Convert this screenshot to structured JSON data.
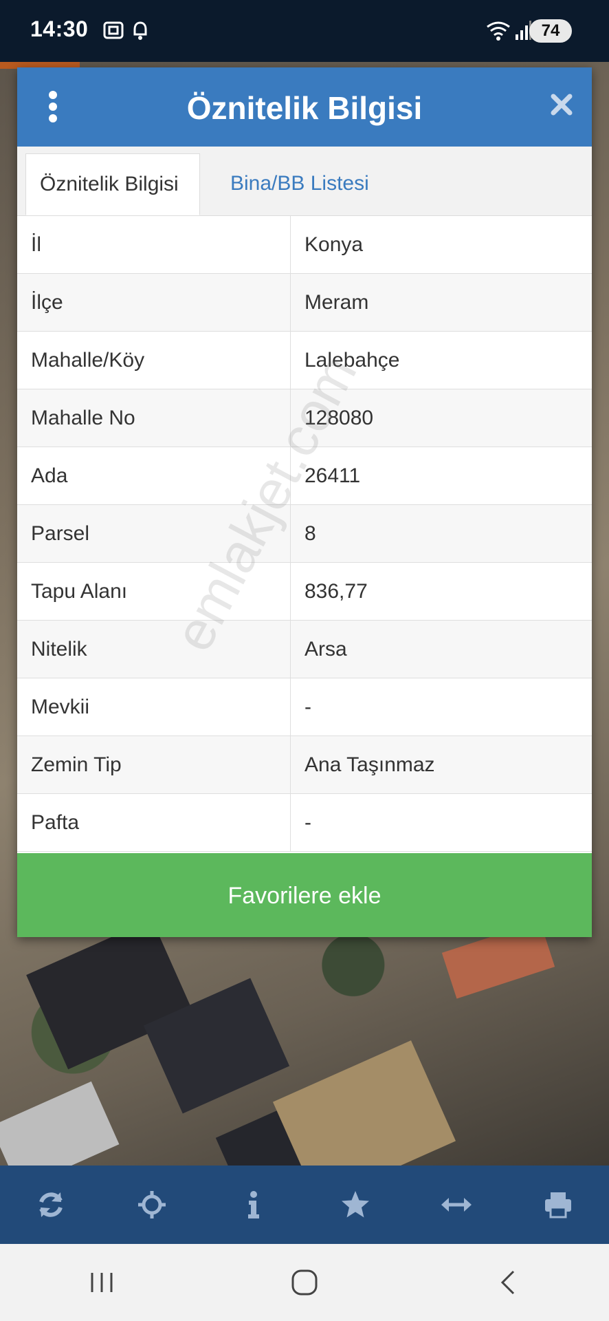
{
  "status_bar": {
    "time": "14:30",
    "battery": "74"
  },
  "dialog": {
    "title": "Öznitelik Bilgisi",
    "tabs": [
      {
        "label": "Öznitelik Bilgisi",
        "active": true
      },
      {
        "label": "Bina/BB Listesi",
        "active": false
      }
    ],
    "rows": [
      {
        "key": "İl",
        "value": "Konya"
      },
      {
        "key": "İlçe",
        "value": "Meram"
      },
      {
        "key": "Mahalle/Köy",
        "value": "Lalebahçe"
      },
      {
        "key": "Mahalle No",
        "value": "128080"
      },
      {
        "key": "Ada",
        "value": "26411"
      },
      {
        "key": "Parsel",
        "value": "8"
      },
      {
        "key": "Tapu Alanı",
        "value": "836,77"
      },
      {
        "key": "Nitelik",
        "value": "Arsa"
      },
      {
        "key": "Mevkii",
        "value": "-"
      },
      {
        "key": "Zemin Tip",
        "value": "Ana Taşınmaz"
      },
      {
        "key": "Pafta",
        "value": "-"
      }
    ],
    "favorite_button": "Favorilere ekle",
    "watermark": "emlakjet.com"
  },
  "toolbar": {
    "icons": [
      "refresh-icon",
      "locate-icon",
      "info-icon",
      "star-icon",
      "measure-icon",
      "print-icon"
    ]
  },
  "colors": {
    "header": "#3a7bbf",
    "favorite": "#5cb85c",
    "toolbar": "#224a79"
  }
}
